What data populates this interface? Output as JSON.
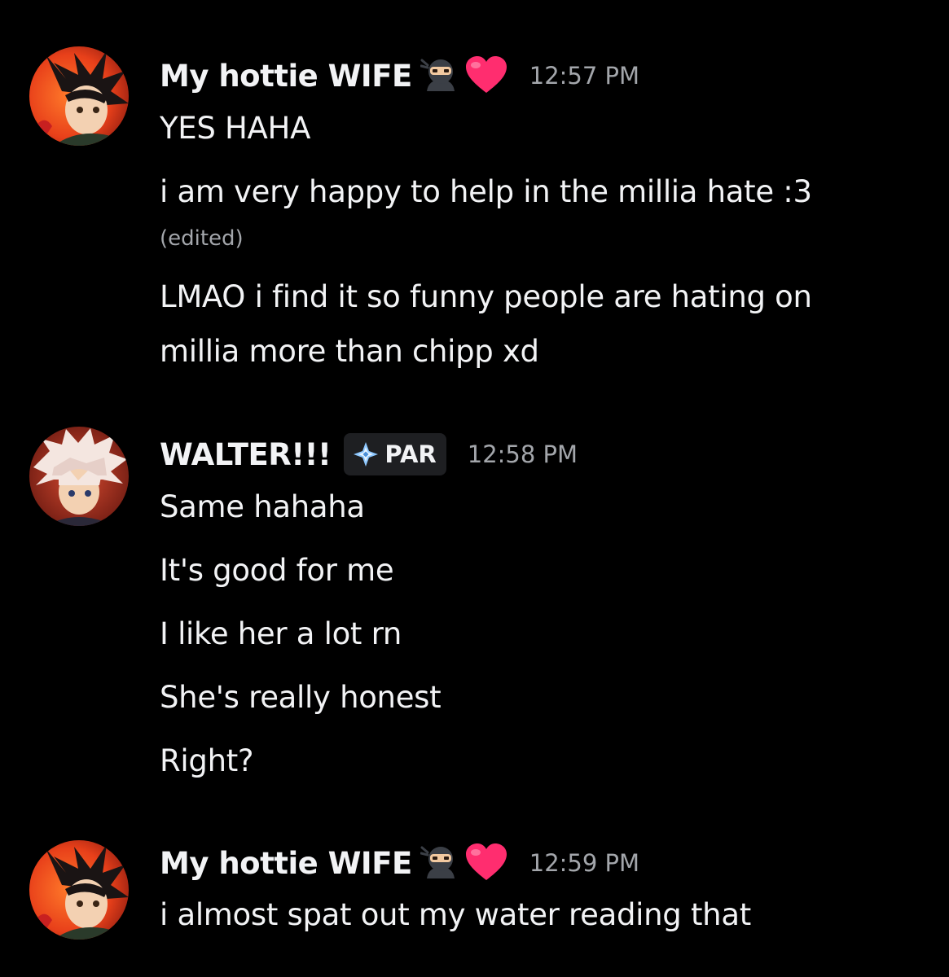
{
  "colors": {
    "background": "#000000",
    "text": "#f2f3f5",
    "muted": "#a3a6ab",
    "tag_background": "#1e1f22",
    "heart": "#ff2d6f"
  },
  "groups": [
    {
      "username": "My hottie WIFE",
      "avatar": "gon-avatar",
      "badges": [
        "ninja-emoji",
        "pink-heart-emoji"
      ],
      "timestamp": "12:57 PM",
      "messages": [
        {
          "text": "YES HAHA"
        },
        {
          "text": "i am very happy to help in the millia hate :3",
          "edited": "(edited)"
        },
        {
          "text": "LMAO i find it so funny people are hating on",
          "text2": "millia more than chipp xd"
        }
      ]
    },
    {
      "username": "WALTER!!!",
      "avatar": "killua-avatar",
      "tag": {
        "icon": "diamond-sparkle-icon",
        "label": "PAR"
      },
      "timestamp": "12:58 PM",
      "messages": [
        {
          "text": "Same hahaha"
        },
        {
          "text": "It's good for me"
        },
        {
          "text": "I like her a lot rn"
        },
        {
          "text": "She's really honest"
        },
        {
          "text": "Right?"
        }
      ]
    },
    {
      "username": "My hottie WIFE",
      "avatar": "gon-avatar",
      "badges": [
        "ninja-emoji",
        "pink-heart-emoji"
      ],
      "timestamp": "12:59 PM",
      "messages": [
        {
          "text": "i almost spat out my water reading that"
        }
      ]
    }
  ]
}
